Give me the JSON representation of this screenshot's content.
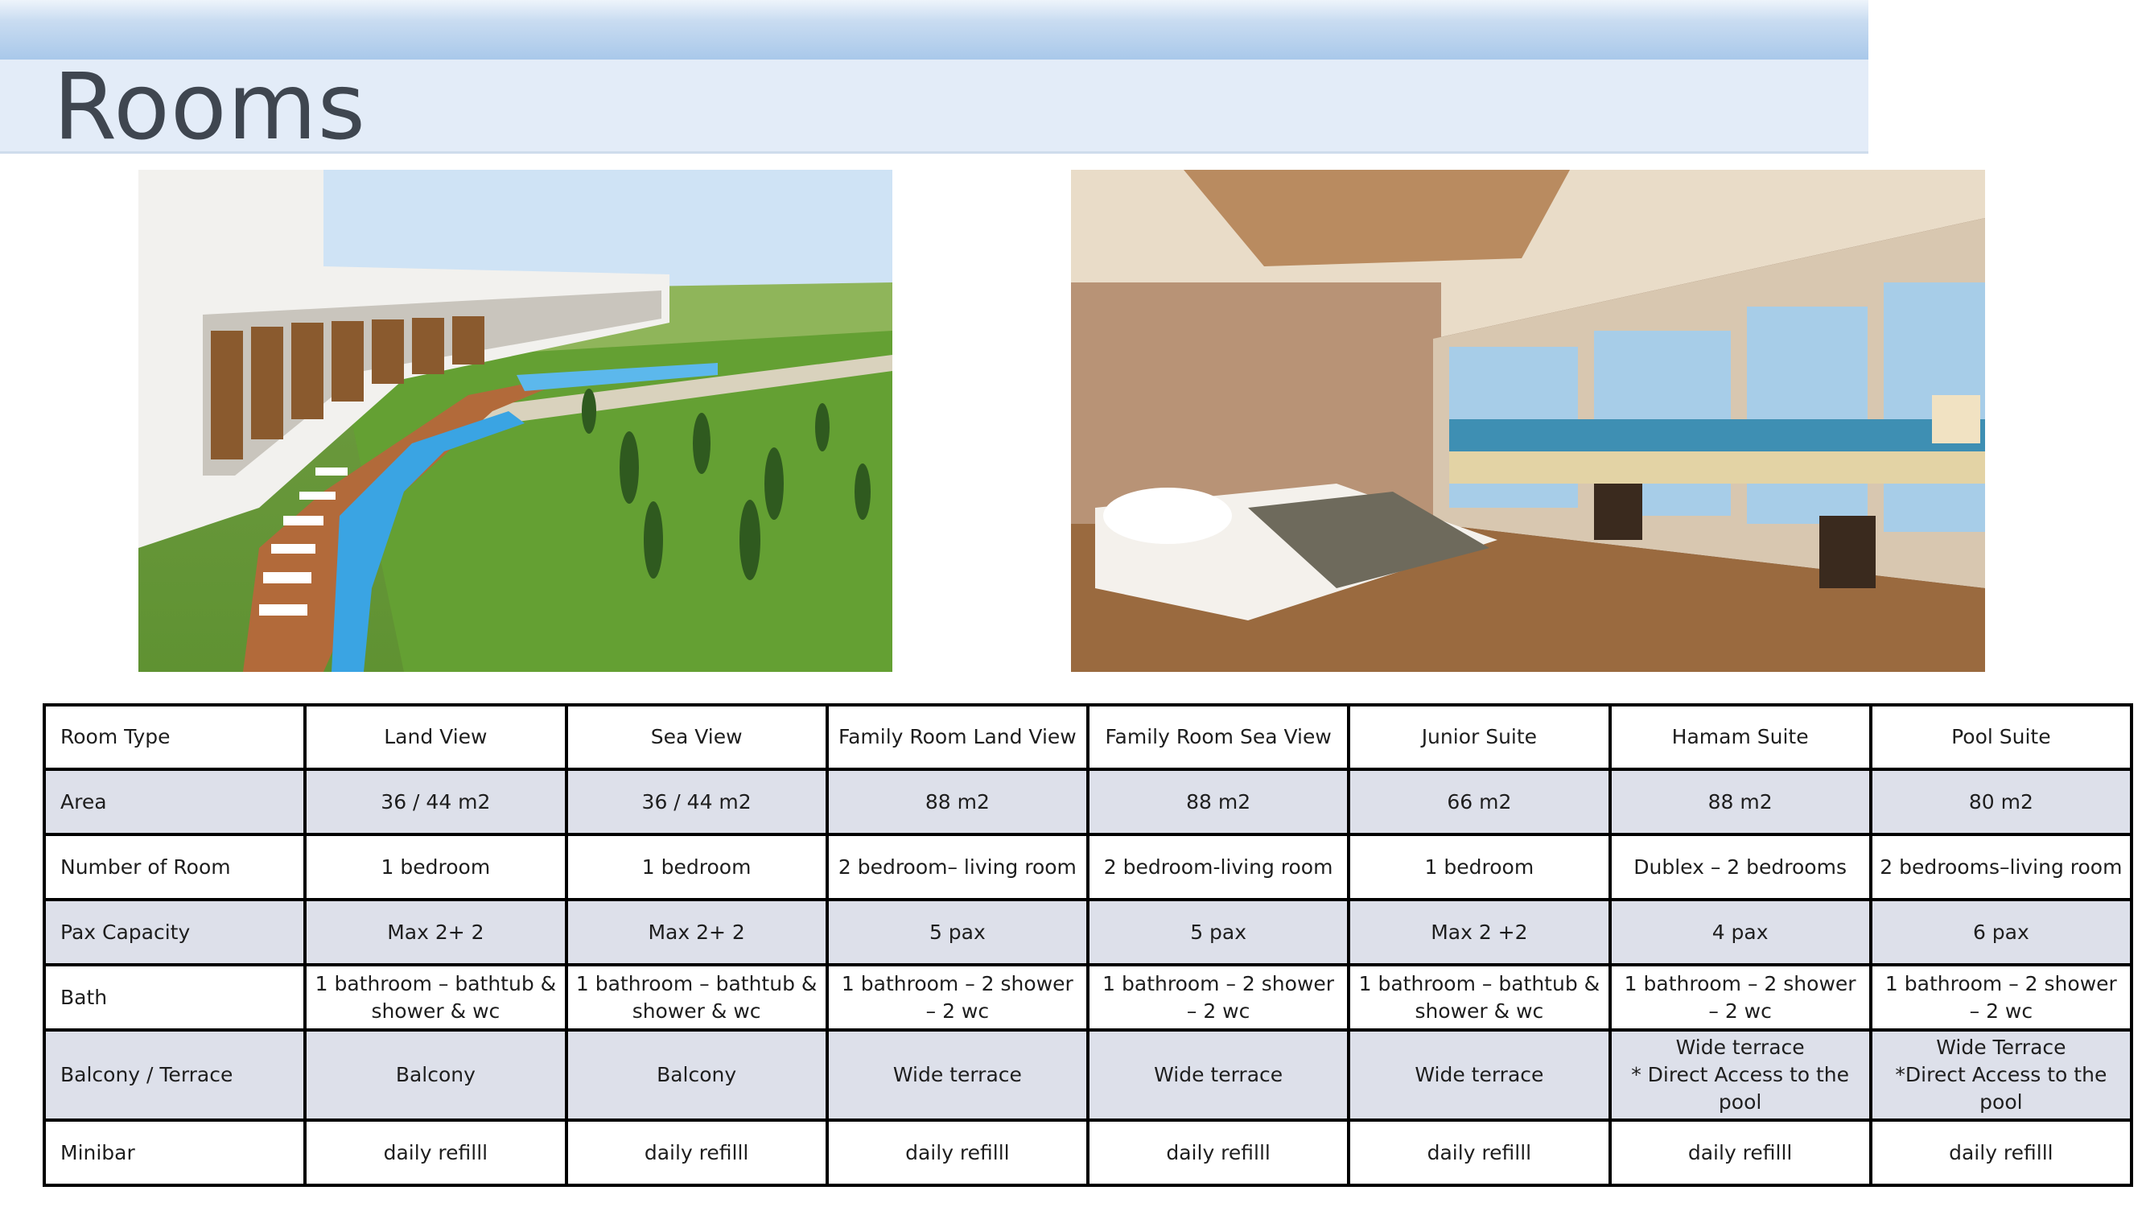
{
  "title": "Rooms",
  "images": [
    {
      "name": "resort-pool-photo",
      "alt": "Resort buildings with long swimming pool and gardens"
    },
    {
      "name": "sea-view-bedroom-photo",
      "alt": "Bedroom with large windows overlooking the sea"
    }
  ],
  "table": {
    "header": {
      "label": "Room Type",
      "values": [
        "Land View",
        "Sea View",
        "Family Room Land View",
        "Family Room Sea View",
        "Junior Suite",
        "Hamam Suite",
        "Pool Suite"
      ]
    },
    "rows": [
      {
        "label": "Area",
        "values": [
          "36 / 44 m2",
          "36 / 44 m2",
          "88 m2",
          "88 m2",
          "66 m2",
          "88 m2",
          "80 m2"
        ]
      },
      {
        "label": "Number of Room",
        "values": [
          "1 bedroom",
          "1 bedroom",
          "2 bedroom– living room",
          "2 bedroom-living room",
          "1 bedroom",
          "Dublex – 2 bedrooms",
          "2 bedrooms–living room"
        ]
      },
      {
        "label": "Pax Capacity",
        "values": [
          "Max 2+ 2",
          "Max 2+ 2",
          "5 pax",
          "5 pax",
          "Max 2 +2",
          "4 pax",
          "6 pax"
        ]
      },
      {
        "label": "Bath",
        "values": [
          "1 bathroom – bathtub & shower & wc",
          "1 bathroom – bathtub & shower & wc",
          "1 bathroom – 2 shower – 2 wc",
          "1 bathroom – 2 shower – 2 wc",
          "1 bathroom – bathtub & shower & wc",
          "1 bathroom – 2 shower – 2 wc",
          "1 bathroom – 2 shower – 2 wc"
        ]
      },
      {
        "label": "Balcony / Terrace",
        "values": [
          "Balcony",
          "Balcony",
          "Wide terrace",
          "Wide terrace",
          "Wide terrace",
          "Wide terrace\n* Direct Access to the pool",
          "Wide Terrace\n*Direct Access to the pool"
        ]
      },
      {
        "label": "Minibar",
        "values": [
          "daily refilll",
          "daily refilll",
          "daily refilll",
          "daily refilll",
          "daily refilll",
          "daily refilll",
          "daily refilll"
        ]
      }
    ]
  }
}
